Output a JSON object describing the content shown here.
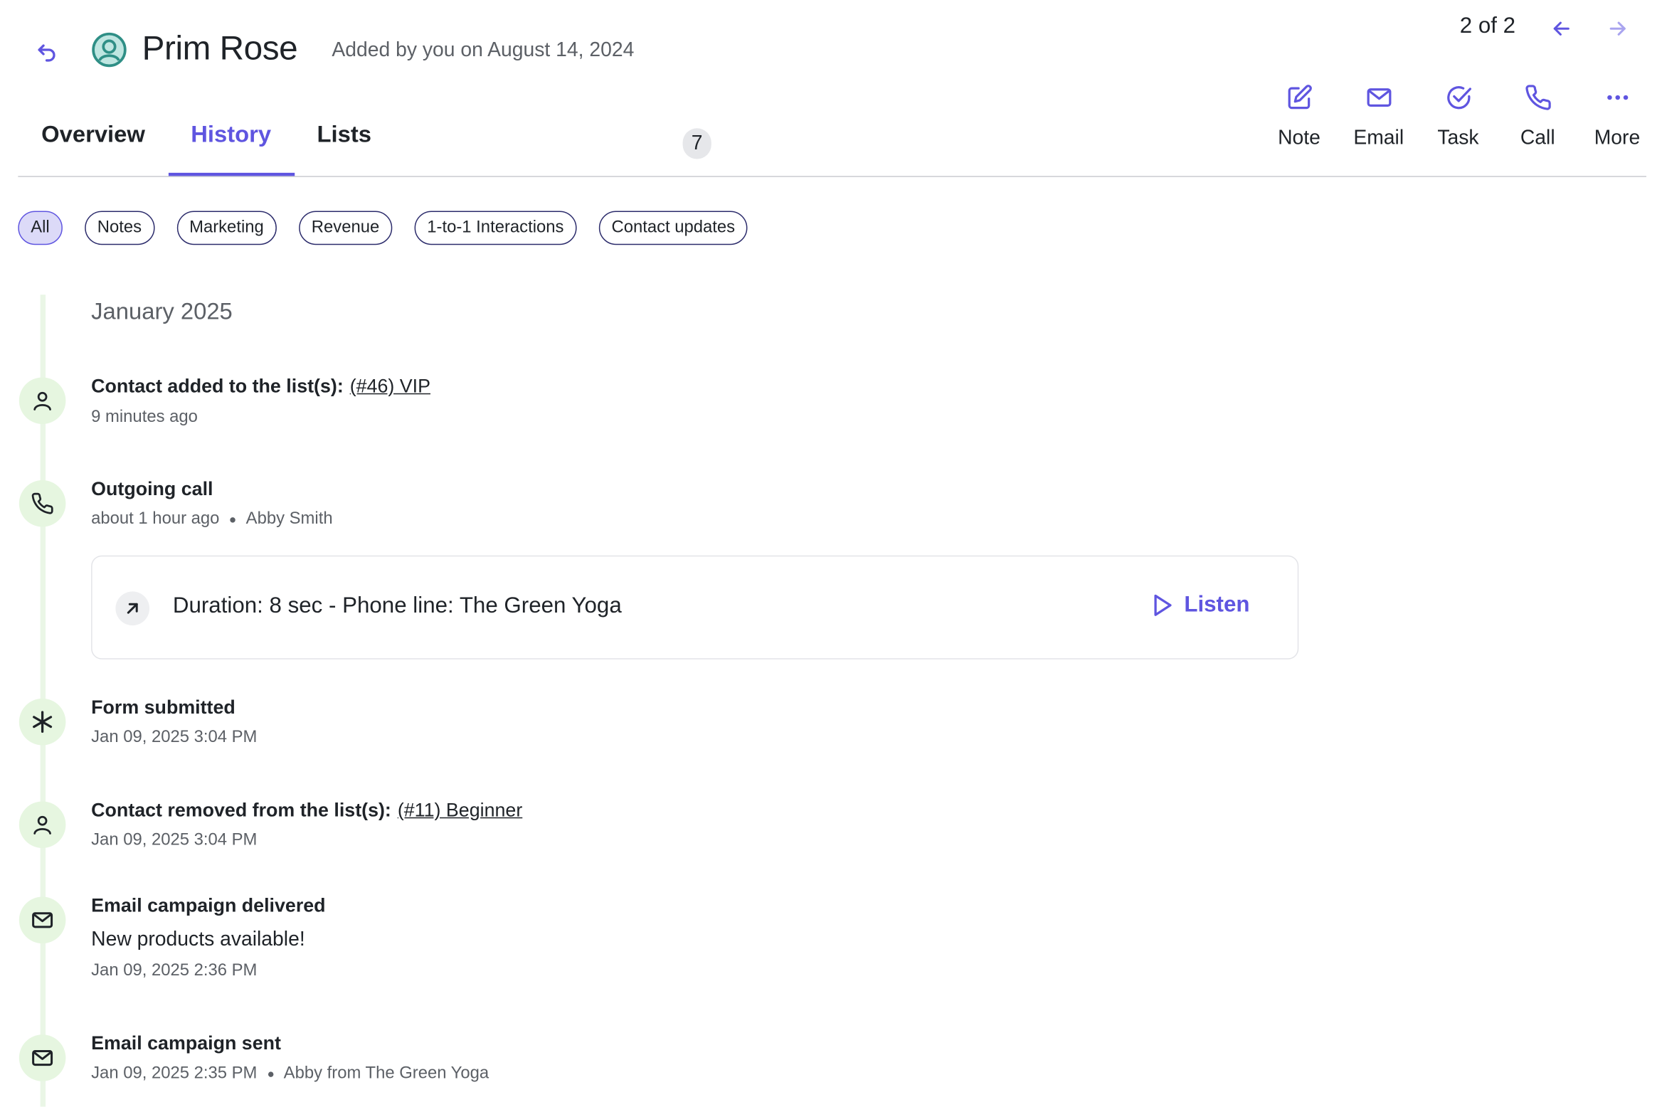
{
  "header": {
    "contact_name": "Prim Rose",
    "added_text": "Added by you on August 14, 2024",
    "pager": "2 of 2"
  },
  "actions": [
    {
      "label": "Note",
      "icon": "edit-icon"
    },
    {
      "label": "Email",
      "icon": "mail-icon"
    },
    {
      "label": "Task",
      "icon": "check-circle-icon"
    },
    {
      "label": "Call",
      "icon": "phone-icon"
    },
    {
      "label": "More",
      "icon": "more-icon"
    }
  ],
  "tabs": [
    {
      "label": "Overview"
    },
    {
      "label": "History",
      "active": true
    },
    {
      "label": "Lists",
      "count": "7"
    }
  ],
  "filters": [
    {
      "label": "All",
      "active": true
    },
    {
      "label": "Notes"
    },
    {
      "label": "Marketing"
    },
    {
      "label": "Revenue"
    },
    {
      "label": "1-to-1 Interactions"
    },
    {
      "label": "Contact updates"
    }
  ],
  "timeline": {
    "month": "January 2025",
    "events": [
      {
        "icon": "user-icon",
        "title": "Contact added to the list(s):",
        "link": "(#46) VIP",
        "time": "9 minutes ago"
      },
      {
        "icon": "phone-icon",
        "title": "Outgoing call",
        "time": "about 1 hour ago",
        "author": "Abby Smith",
        "call": {
          "detail": "Duration: 8 sec - Phone line: The Green Yoga",
          "listen_label": "Listen"
        }
      },
      {
        "icon": "asterisk-icon",
        "title": "Form submitted",
        "time": "Jan 09, 2025 3:04 PM"
      },
      {
        "icon": "user-icon",
        "title": "Contact removed from the list(s):",
        "link": "(#11) Beginner",
        "time": "Jan 09, 2025 3:04 PM"
      },
      {
        "icon": "mail-icon",
        "title": "Email campaign delivered",
        "body": "New products available!",
        "time": "Jan 09, 2025 2:36 PM"
      },
      {
        "icon": "mail-icon",
        "title": "Email campaign sent",
        "time": "Jan 09, 2025 2:35 PM",
        "author": "Abby from The Green Yoga"
      }
    ]
  },
  "colors": {
    "accent": "#5f55e0",
    "timeline_bg": "#e6f6e0",
    "chip_active_bg": "#dcdaf8",
    "avatar": "#2f8f86"
  }
}
